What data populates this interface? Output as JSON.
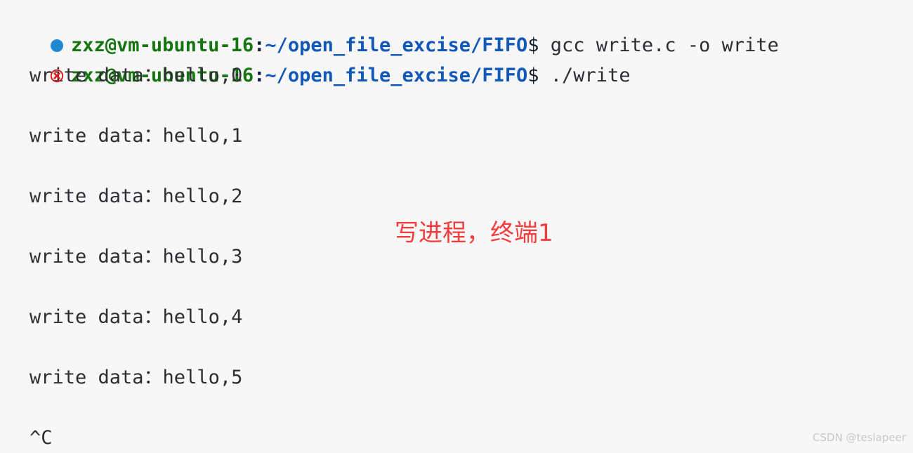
{
  "terminal": {
    "background_color": "#f7f7f7",
    "foreground_color": "#2d2d33",
    "user_host_color": "#15750f",
    "path_color": "#1258b8",
    "prompt": {
      "user_host": "zxz@vm-ubuntu-16",
      "separator": ":",
      "path": "~/open_file_excise/FIFO",
      "sigil": "$"
    },
    "lines": [
      {
        "type": "prompt",
        "marker": "status-dot-running-icon",
        "marker_color": "#2089d0",
        "command": " gcc write.c -o write"
      },
      {
        "type": "prompt",
        "marker": "status-error-circle-x-icon",
        "marker_color": "#e01b1b",
        "command": " ./write"
      },
      {
        "type": "output",
        "text": "write data：hello,0"
      },
      {
        "type": "blank",
        "text": ""
      },
      {
        "type": "output",
        "text": "write data：hello,1"
      },
      {
        "type": "blank",
        "text": ""
      },
      {
        "type": "output",
        "text": "write data：hello,2"
      },
      {
        "type": "blank",
        "text": ""
      },
      {
        "type": "output",
        "text": "write data：hello,3"
      },
      {
        "type": "blank",
        "text": ""
      },
      {
        "type": "output",
        "text": "write data：hello,4"
      },
      {
        "type": "blank",
        "text": ""
      },
      {
        "type": "output",
        "text": "write data：hello,5"
      },
      {
        "type": "blank",
        "text": ""
      },
      {
        "type": "output",
        "text": "^C"
      }
    ]
  },
  "annotation": {
    "text": "写进程，终端1",
    "color": "#f53c3c"
  },
  "watermark": {
    "text": "CSDN @teslapeer",
    "color": "#c8c8c8"
  }
}
